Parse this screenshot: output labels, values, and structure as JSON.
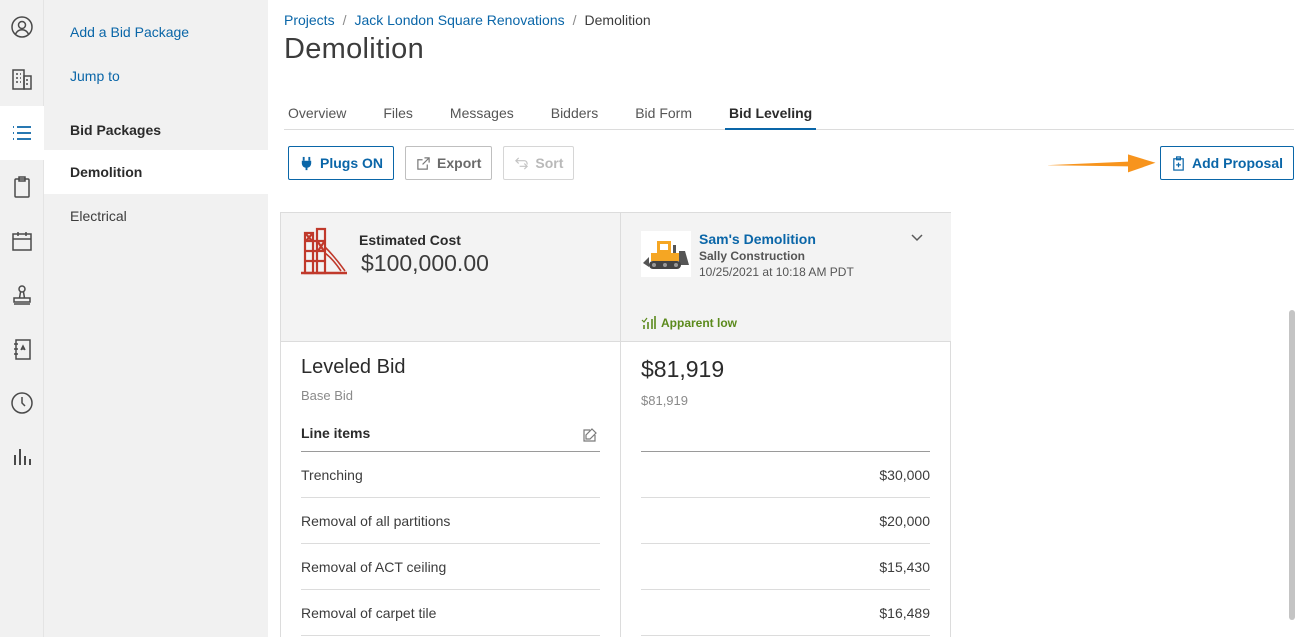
{
  "rail": {
    "items": [
      {
        "name": "user-icon"
      },
      {
        "name": "building-icon"
      },
      {
        "name": "list-icon",
        "active": true
      },
      {
        "name": "clipboard-icon"
      },
      {
        "name": "calendar-icon"
      },
      {
        "name": "stamp-icon"
      },
      {
        "name": "notebook-icon"
      },
      {
        "name": "clock-icon"
      },
      {
        "name": "bar-chart-icon"
      }
    ]
  },
  "subnav": {
    "add_bid_package": "Add a Bid Package",
    "jump_to": "Jump to",
    "section_heading": "Bid Packages",
    "items": [
      "Demolition",
      "Electrical"
    ]
  },
  "breadcrumb": {
    "items": [
      "Projects",
      "Jack London Square Renovations",
      "Demolition"
    ],
    "separator": "/"
  },
  "page_title": "Demolition",
  "tabs": [
    "Overview",
    "Files",
    "Messages",
    "Bidders",
    "Bid Form",
    "Bid Leveling"
  ],
  "active_tab": "Bid Leveling",
  "toolbar": {
    "plugs": "Plugs ON",
    "export": "Export",
    "sort": "Sort",
    "add_proposal": "Add Proposal"
  },
  "estimate": {
    "label": "Estimated Cost",
    "value": "$100,000.00"
  },
  "bidder": {
    "name": "Sam's Demolition",
    "company": "Sally Construction",
    "date": "10/25/2021 at 10:18 AM PDT",
    "status": "Apparent low",
    "total": "$81,919",
    "base_total": "$81,919"
  },
  "leveled": {
    "title": "Leveled Bid",
    "subtitle": "Base Bid",
    "line_items_header": "Line items"
  },
  "line_items": [
    {
      "label": "Trenching",
      "amount": "$30,000"
    },
    {
      "label": "Removal of all partitions",
      "amount": "$20,000"
    },
    {
      "label": "Removal of ACT ceiling",
      "amount": "$15,430"
    },
    {
      "label": "Removal of carpet tile",
      "amount": "$16,489"
    }
  ],
  "colors": {
    "link": "#0a66a8",
    "accent_arrow": "#f7941d",
    "success": "#5b8a1c",
    "bridge": "#c0392b",
    "dozer": "#f5a623"
  }
}
